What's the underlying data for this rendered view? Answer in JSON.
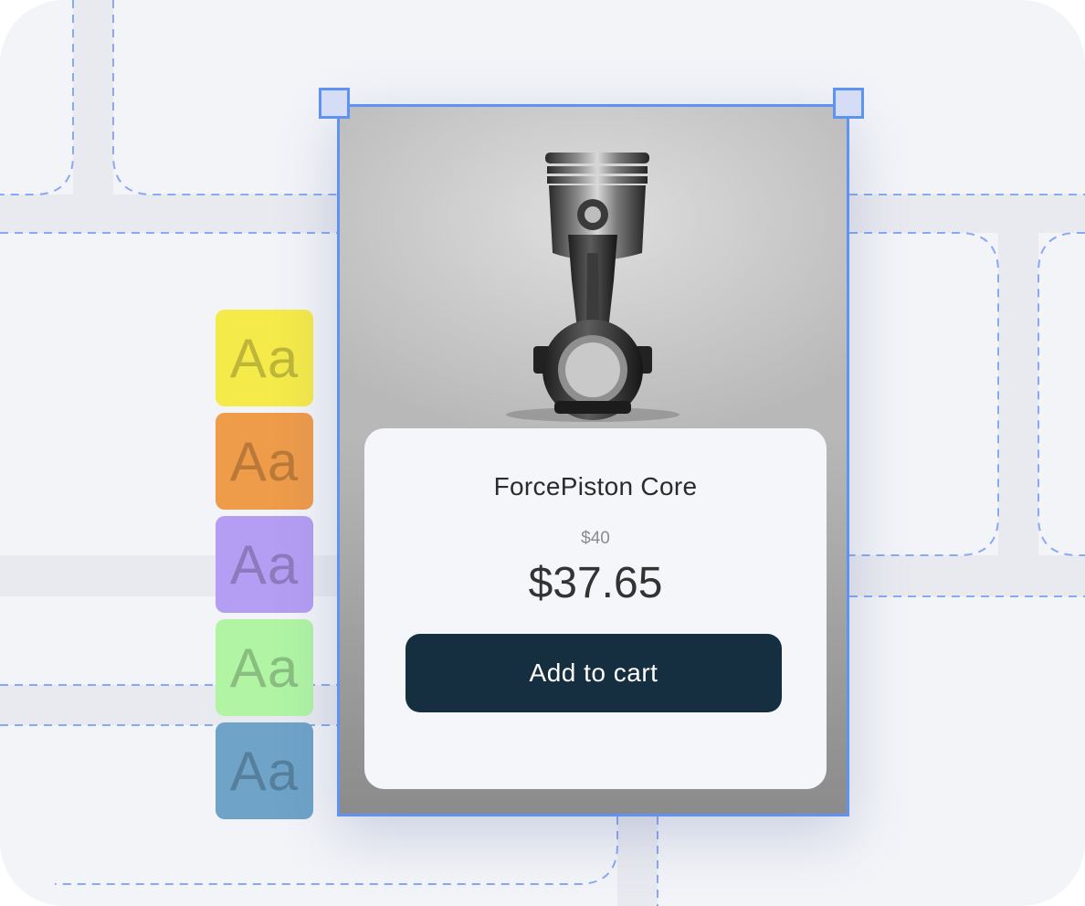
{
  "product": {
    "title": "ForcePiston Core",
    "original_price": "$40",
    "sale_price": "$37.65",
    "add_to_cart_label": "Add to cart",
    "image_icon": "piston-image"
  },
  "typography_swatches": [
    {
      "label": "Aa",
      "color": "#f4ea4a"
    },
    {
      "label": "Aa",
      "color": "#ee9b4a"
    },
    {
      "label": "Aa",
      "color": "#b39ef3"
    },
    {
      "label": "Aa",
      "color": "#b0f4a4"
    },
    {
      "label": "Aa",
      "color": "#6fa3c8"
    }
  ],
  "colors": {
    "selection_accent": "#5f93f2",
    "cart_button": "#152f40",
    "canvas_background": "#f3f4f8"
  }
}
